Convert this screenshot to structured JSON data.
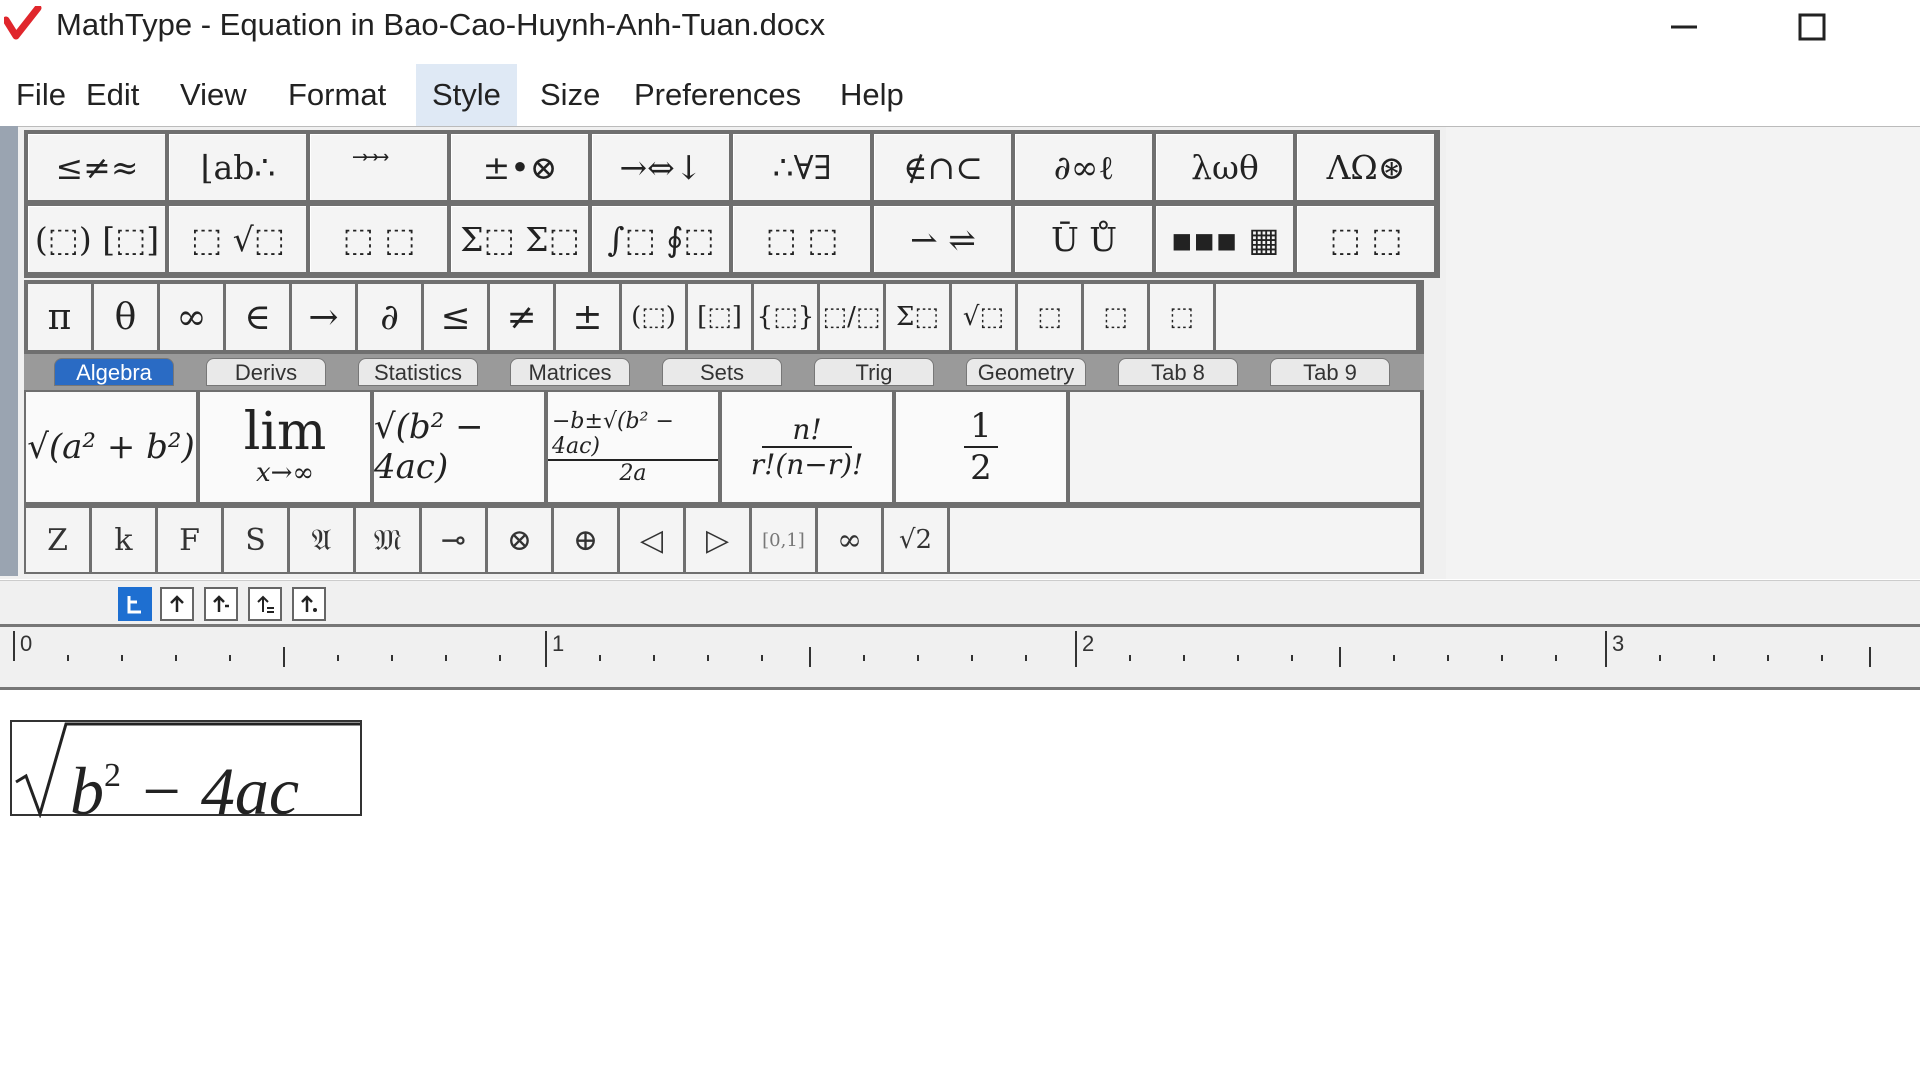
{
  "window": {
    "title": "MathType - Equation in Bao-Cao-Huynh-Anh-Tuan.docx"
  },
  "colors": {
    "accent": "#1e6fd1",
    "logo": "#e0262c",
    "active_tab": "#2a6bc4"
  },
  "menu": [
    {
      "label": "File"
    },
    {
      "label": "Edit"
    },
    {
      "label": "View"
    },
    {
      "label": "Format"
    },
    {
      "label": "Style"
    },
    {
      "label": "Size"
    },
    {
      "label": "Preferences"
    },
    {
      "label": "Help"
    }
  ],
  "palettes": {
    "row1": [
      "≤≠≈",
      "⌊ab∴",
      "⃗ ⃗ ⃗",
      "±•⊗",
      "→⇔↓",
      "∴∀∃",
      "∉∩⊂",
      "∂∞ℓ",
      "λωθ",
      "ΛΩ⊛"
    ],
    "row2": [
      "(⬚) [⬚]",
      "⬚ √⬚",
      "⬚ ⬚",
      "Σ⬚ Σ⬚",
      "∫⬚ ∮⬚",
      "⬚ ⬚",
      "⇀ ⇌",
      "Ū Ů",
      "▪▪▪ ▦",
      "⬚ ⬚"
    ]
  },
  "symbols": [
    "π",
    "θ",
    "∞",
    "∈",
    "→",
    "∂",
    "≤",
    "≠",
    "±",
    "(⬚)",
    "[⬚]",
    "{⬚}",
    "⬚/⬚",
    "Σ⬚",
    "√⬚",
    "⬚",
    "⬚",
    "⬚"
  ],
  "tabs": [
    "Algebra",
    "Derivs",
    "Statistics",
    "Matrices",
    "Sets",
    "Trig",
    "Geometry",
    "Tab 8",
    "Tab 9"
  ],
  "templates": {
    "t1": "√(a² + b²)",
    "lim": "lim",
    "lim_sub": "x→∞",
    "t3": "√(b² − 4ac)",
    "t4_num": "−b±√(b² − 4ac)",
    "t4_den": "2a",
    "t5_num": "n!",
    "t5_den": "r!(n−r)!",
    "t6_num": "1",
    "t6_den": "2"
  },
  "small_symbols": [
    "Z",
    "k",
    "F",
    "S",
    "𝔄",
    "𝔐",
    "⊸",
    "⊗",
    "⊕",
    "◁",
    "▷",
    "[0,1]",
    "∞",
    "√2"
  ],
  "nudge_icons": [
    "tab-align-icon",
    "up-arrow-icon",
    "up-arrow-icon",
    "up-arrow-icon",
    "up-arrow-icon"
  ],
  "ruler": {
    "labels": [
      "0",
      "1",
      "2",
      "3"
    ]
  },
  "equation": {
    "radical": "√",
    "b": "b",
    "exp": "2",
    "rest": "− 4ac"
  }
}
